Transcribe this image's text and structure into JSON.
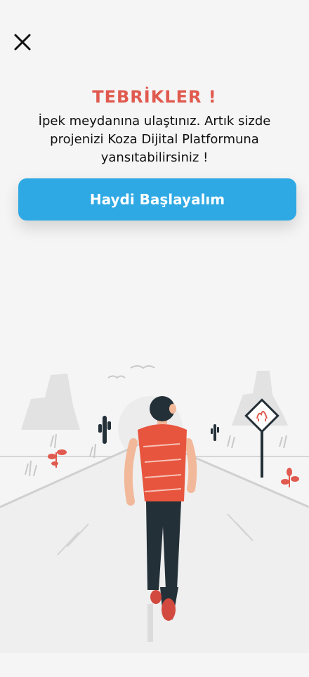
{
  "header": {
    "close_icon": "close-icon"
  },
  "main": {
    "title": "TEBRİKLER !",
    "message": "İpek meydanına ulaştınız. Artık sizde projenizi Koza Dijital Platformuna yansıtabilirsiniz !",
    "cta_label": "Haydi Başlayalım"
  },
  "colors": {
    "accent": "#2ea9e4",
    "title": "#e05a4f",
    "background": "#f5f5f5"
  },
  "illustration": {
    "icon": "walking-person-illustration"
  }
}
